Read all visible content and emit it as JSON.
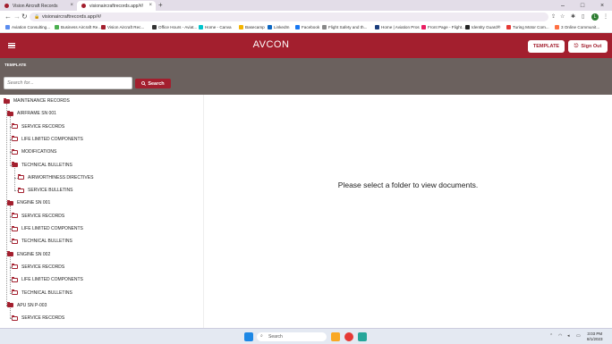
{
  "browser": {
    "tabs": [
      {
        "title": "Vision Aircraft Records",
        "active": false
      },
      {
        "title": "visionaircraftrecords.app/#/",
        "active": true
      }
    ],
    "url": "visionaircraftrecords.app/#/",
    "profile_initial": "L",
    "bookmarks": [
      {
        "label": "Aviation Consulting...",
        "color": "#5b8def"
      },
      {
        "label": "Business Aircraft Re...",
        "color": "#4caf50"
      },
      {
        "label": "Vision Aircraft Rec...",
        "color": "#a31f2e"
      },
      {
        "label": "Office Hours - Aviat...",
        "color": "#333333"
      },
      {
        "label": "Home - Canva",
        "color": "#00c4cc"
      },
      {
        "label": "Basecamp",
        "color": "#f4b400"
      },
      {
        "label": "LinkedIn",
        "color": "#0a66c2"
      },
      {
        "label": "Facebook",
        "color": "#1877f2"
      },
      {
        "label": "Flight Safety and th...",
        "color": "#888888"
      },
      {
        "label": "Home | Aviation Pros",
        "color": "#1a3d7c"
      },
      {
        "label": "Front Page - Flight...",
        "color": "#e91e63"
      },
      {
        "label": "Identity Guard®",
        "color": "#222222"
      },
      {
        "label": "Turing Motor Com...",
        "color": "#e53935"
      },
      {
        "label": "3 Online Communit...",
        "color": "#ff7043"
      }
    ]
  },
  "header": {
    "title": "AVCON",
    "template_button": "TEMPLATE",
    "signout_button": "Sign Out"
  },
  "subbar": {
    "label": "TEMPLATE",
    "search_placeholder": "Search for...",
    "search_button": "Search"
  },
  "tree": [
    {
      "label": "MAINTENANCE RECORDS",
      "level": 0,
      "filled": true
    },
    {
      "label": "AIRFRAME SN 001",
      "level": 1,
      "filled": true
    },
    {
      "label": "SERVICE RECORDS",
      "level": 2,
      "filled": false
    },
    {
      "label": "LIFE LIMITED COMPONENTS",
      "level": 2,
      "filled": false
    },
    {
      "label": "MODIFICATIONS",
      "level": 2,
      "filled": false
    },
    {
      "label": "TECHNICAL BULLETINS",
      "level": 2,
      "filled": true
    },
    {
      "label": "AIRWORTHINESS DIRECTIVES",
      "level": 3,
      "filled": false
    },
    {
      "label": "SERVICE BULLETINS",
      "level": 3,
      "filled": false
    },
    {
      "label": "ENGINE SN 001",
      "level": 1,
      "filled": true
    },
    {
      "label": "SERVICE RECORDS",
      "level": 2,
      "filled": false
    },
    {
      "label": "LIFE LIMITED COMPONENTS",
      "level": 2,
      "filled": false
    },
    {
      "label": "TECHNICAL BULLETINS",
      "level": 2,
      "filled": false
    },
    {
      "label": "ENGINE SN 002",
      "level": 1,
      "filled": true
    },
    {
      "label": "SERVICE RECORDS",
      "level": 2,
      "filled": false
    },
    {
      "label": "LIFE LIMITED COMPONENTS",
      "level": 2,
      "filled": false
    },
    {
      "label": "TECHNICAL BULLETINS",
      "level": 2,
      "filled": false
    },
    {
      "label": "APU SN P-003",
      "level": 1,
      "filled": true
    },
    {
      "label": "SERVICE RECORDS",
      "level": 2,
      "filled": false
    }
  ],
  "main": {
    "placeholder": "Please select a folder to view documents."
  },
  "taskbar": {
    "search_label": "Search",
    "time": "3:03 PM",
    "date": "8/1/2023"
  },
  "colors": {
    "brand": "#a31f2e",
    "subbar": "#6b615e"
  }
}
